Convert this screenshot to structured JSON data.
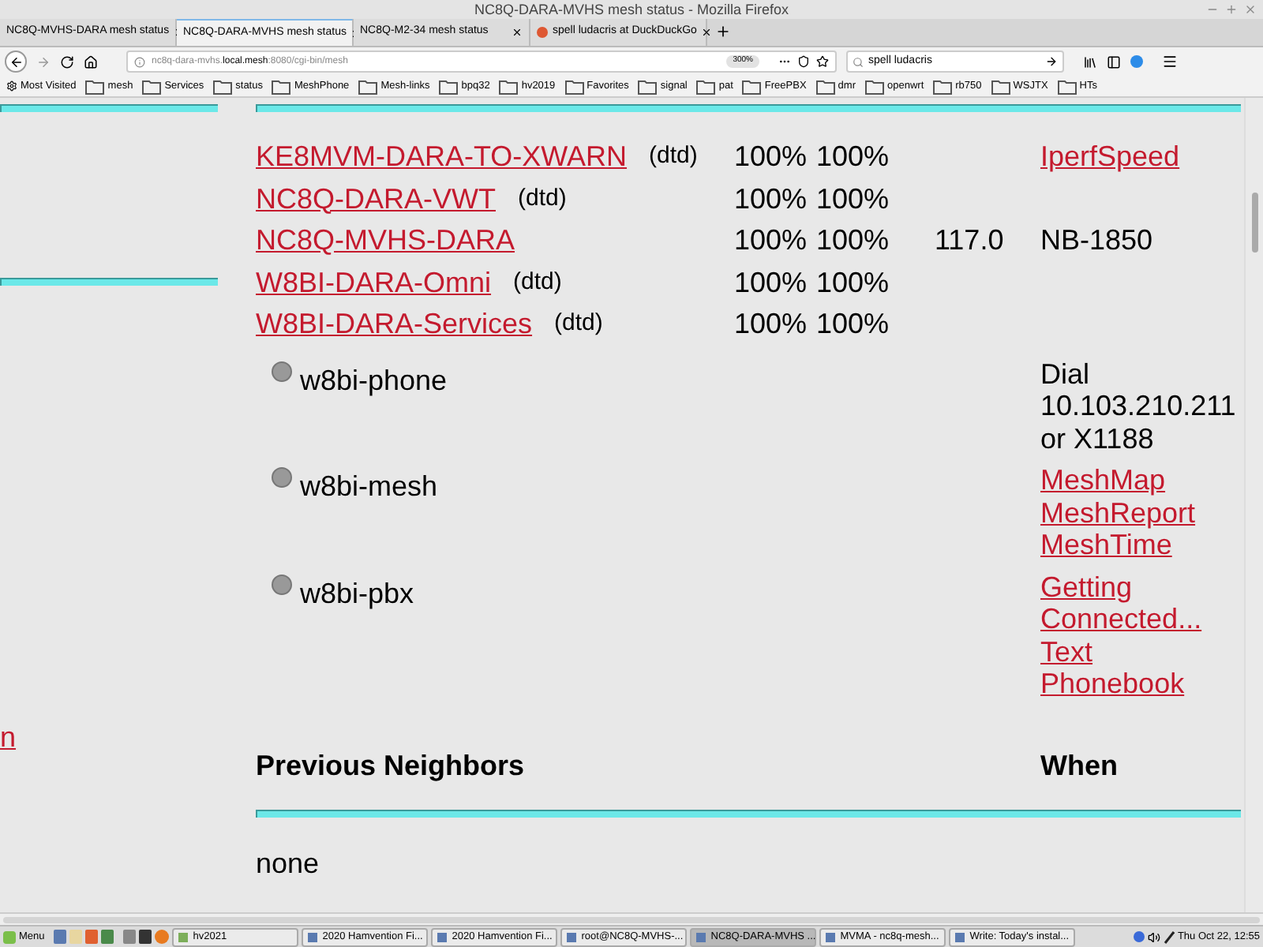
{
  "window": {
    "title": "NC8Q-DARA-MVHS mesh status - Mozilla Firefox"
  },
  "tabs": [
    {
      "label": "NC8Q-MVHS-DARA mesh status",
      "selected": false,
      "favicon": false
    },
    {
      "label": "NC8Q-DARA-MVHS mesh status",
      "selected": true,
      "favicon": false
    },
    {
      "label": "NC8Q-M2-34 mesh status",
      "selected": false,
      "favicon": false
    },
    {
      "label": "spell ludacris at DuckDuckGo",
      "selected": false,
      "favicon": true
    }
  ],
  "address_bar": {
    "url_prefix": "nc8q-dara-mvhs.",
    "url_domain": "local.mesh",
    "url_suffix": ":8080/cgi-bin/mesh",
    "zoom": "300%"
  },
  "search": {
    "value": "spell ludacris"
  },
  "bookmarks": [
    "Most Visited",
    "mesh",
    "Services",
    "status",
    "MeshPhone",
    "Mesh-links",
    "bpq32",
    "hv2019",
    "Favorites",
    "signal",
    "pat",
    "FreePBX",
    "dmr",
    "openwrt",
    "rb750",
    "WSJTX",
    "HTs"
  ],
  "left_column": {
    "link": "n"
  },
  "neighbors": [
    {
      "name": "KE8MVM-DARA-TO-XWARN",
      "note": "(dtd)",
      "lq": "100%",
      "nlq": "100%",
      "service": {
        "kind": "link",
        "text": "IperfSpeed"
      }
    },
    {
      "name": "NC8Q-DARA-VWT",
      "note": "(dtd)",
      "lq": "100%",
      "nlq": "100%"
    },
    {
      "name": "NC8Q-MVHS-DARA",
      "lq": "100%",
      "nlq": "100%",
      "cost": "117.0",
      "service": {
        "kind": "text",
        "text": "NB-1850"
      }
    },
    {
      "name": "W8BI-DARA-Omni",
      "note": "(dtd)",
      "lq": "100%",
      "nlq": "100%"
    },
    {
      "name": "W8BI-DARA-Services",
      "note": "(dtd)",
      "lq": "100%",
      "nlq": "100%"
    }
  ],
  "hosts": [
    {
      "name": "w8bi-phone",
      "services": [
        {
          "kind": "text",
          "text": "Dial 10.103.210.211 or X1188"
        }
      ]
    },
    {
      "name": "w8bi-mesh",
      "services": [
        {
          "kind": "link",
          "text": "MeshMap"
        },
        {
          "kind": "link",
          "text": "MeshReport"
        },
        {
          "kind": "link",
          "text": "MeshTime"
        }
      ]
    },
    {
      "name": "w8bi-pbx",
      "services": [
        {
          "kind": "link",
          "text": "Getting Connected..."
        },
        {
          "kind": "link",
          "text": "Text"
        },
        {
          "kind": "link",
          "text": "Phonebook"
        }
      ]
    }
  ],
  "previous_neighbors": {
    "heading": "Previous Neighbors",
    "when_heading": "When",
    "empty_text": "none"
  },
  "taskbar": {
    "menu": "Menu",
    "windows": [
      {
        "label": "hv2021",
        "selected": false
      },
      {
        "label": "2020 Hamvention Fi...",
        "selected": false
      },
      {
        "label": "2020 Hamvention Fi...",
        "selected": false
      },
      {
        "label": "root@NC8Q-MVHS-...",
        "selected": false
      },
      {
        "label": "NC8Q-DARA-MVHS ...",
        "selected": true
      },
      {
        "label": "MVMA - nc8q-mesh...",
        "selected": false
      },
      {
        "label": "Write: Today's instal...",
        "selected": false
      }
    ],
    "clock": "Thu Oct 22, 12:55"
  }
}
